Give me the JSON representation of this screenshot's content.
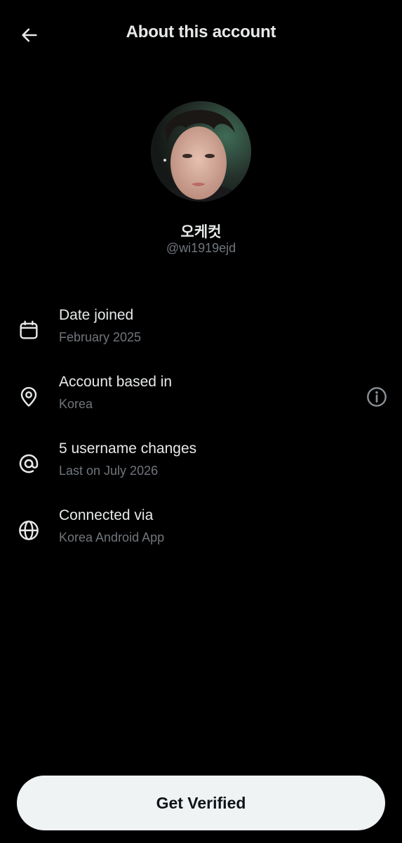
{
  "header": {
    "title": "About this account",
    "back_icon": "arrow-left-icon"
  },
  "profile": {
    "display_name": "오케컷",
    "handle": "@wi1919ejd",
    "avatar_icon": "avatar"
  },
  "info": [
    {
      "icon": "calendar-icon",
      "label": "Date joined",
      "value": "February 2025"
    },
    {
      "icon": "location-pin-icon",
      "label": "Account based in",
      "value": "Korea",
      "action_icon": "info-icon"
    },
    {
      "icon": "at-sign-icon",
      "label": "5 username changes",
      "value": "Last on July 2026"
    },
    {
      "icon": "globe-icon",
      "label": "Connected via",
      "value": "Korea Android App"
    }
  ],
  "footer": {
    "button_label": "Get Verified"
  },
  "colors": {
    "background": "#000000",
    "primary_text": "#e7e9ea",
    "secondary_text": "#71767b",
    "button_bg": "#eff3f4",
    "button_text": "#0f1419"
  }
}
